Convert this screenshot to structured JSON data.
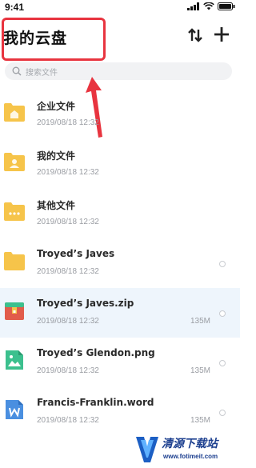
{
  "status": {
    "time": "9:41"
  },
  "header": {
    "title": "我的云盘"
  },
  "search": {
    "placeholder": "搜索文件"
  },
  "files": [
    {
      "name": "企业文件",
      "date": "2019/08/18 12:32",
      "size": "",
      "icon": "folder-enterprise-icon"
    },
    {
      "name": "我的文件",
      "date": "2019/08/18 12:32",
      "size": "",
      "icon": "folder-user-icon"
    },
    {
      "name": "其他文件",
      "date": "2019/08/18 12:32",
      "size": "",
      "icon": "folder-other-icon"
    },
    {
      "name": "Troyed’s Javes",
      "date": "2019/08/18 12:32",
      "size": "",
      "icon": "folder-icon"
    },
    {
      "name": "Troyed’s Javes.zip",
      "date": "2019/08/18 12:32",
      "size": "135M",
      "icon": "zip-file-icon"
    },
    {
      "name": "Troyed’s Glendon.png",
      "date": "2019/08/18 12:32",
      "size": "135M",
      "icon": "image-file-icon"
    },
    {
      "name": "Francis-Franklin.word",
      "date": "2019/08/18 12:32",
      "size": "135M",
      "icon": "word-file-icon"
    }
  ],
  "watermark": {
    "text": "清源下载站",
    "url": "www.fotimeit.com"
  },
  "colors": {
    "folder": "#f6c44a",
    "annotation": "#e8343f",
    "highlight": "#eef5fc",
    "zip": "#e25c4b",
    "image": "#3cc08e",
    "word": "#4a8fe0"
  }
}
